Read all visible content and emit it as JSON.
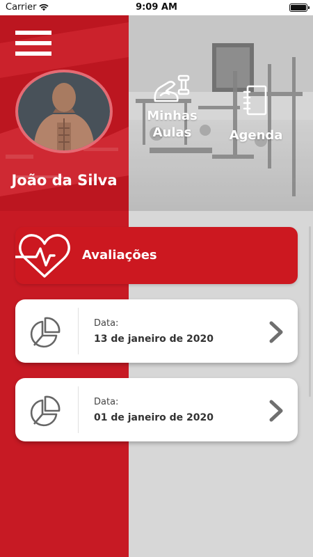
{
  "status_bar": {
    "carrier": "Carrier",
    "time": "9:09 AM",
    "wifi_icon": "wifi-icon",
    "battery_icon": "battery-icon"
  },
  "header": {
    "menu_icon": "hamburger-menu-icon",
    "user_name": "João da Silva",
    "quick_actions": [
      {
        "label": "Minhas Aulas",
        "icon": "bicep-dumbbell-icon"
      },
      {
        "label": "Agenda",
        "icon": "notebook-icon"
      }
    ]
  },
  "section": {
    "title": "Avaliações",
    "icon": "heart-pulse-icon"
  },
  "evaluations": [
    {
      "label": "Data:",
      "date": "13 de janeiro de 2020",
      "icon": "pie-chart-icon"
    },
    {
      "label": "Data:",
      "date": "01 de janeiro de 2020",
      "icon": "pie-chart-icon"
    }
  ],
  "colors": {
    "primary_red": "#c71a24",
    "banner_red": "#cc1820",
    "background_gray": "#d7d7d7",
    "card_white": "#ffffff",
    "avatar_ring": "#e56a73"
  }
}
